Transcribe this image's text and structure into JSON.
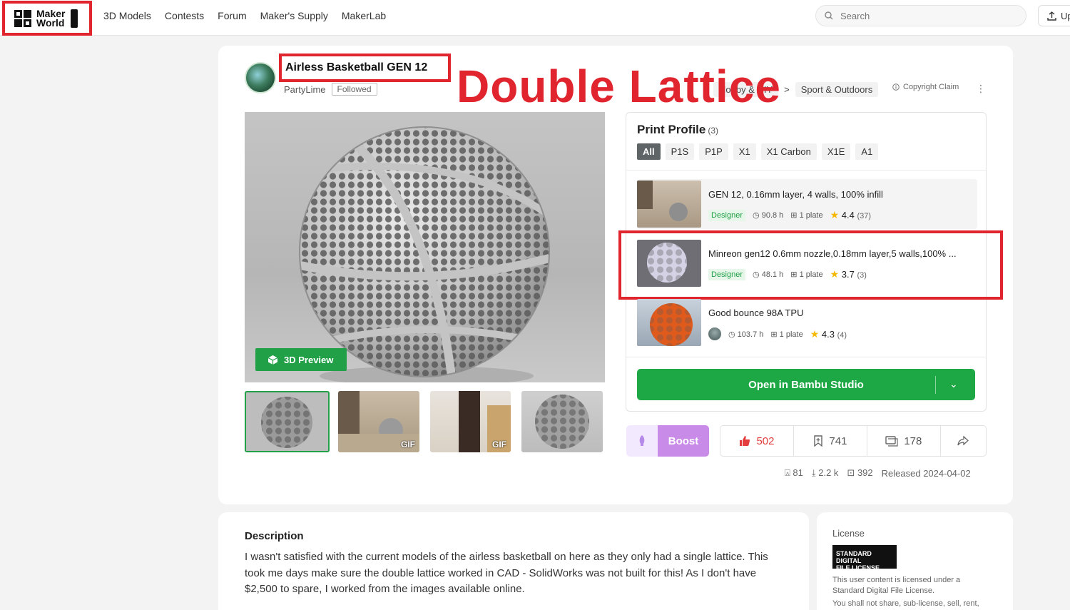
{
  "header": {
    "logo_text_line1": "Maker",
    "logo_text_line2": "World",
    "nav": [
      "3D Models",
      "Contests",
      "Forum",
      "Maker's Supply",
      "MakerLab"
    ],
    "search_placeholder": "Search",
    "upload_label": "Up"
  },
  "model": {
    "title": "Airless Basketball GEN 12",
    "author": "PartyLime",
    "follow_label": "Followed",
    "annotation": "Double Lattice",
    "breadcrumb": [
      "Hobby & DIY",
      "Sport & Outdoors"
    ],
    "copyright_label": "Copyright Claim",
    "preview_label": "3D Preview",
    "thumbnails": [
      {
        "gif": ""
      },
      {
        "gif": "GIF"
      },
      {
        "gif": "GIF"
      },
      {
        "gif": ""
      }
    ]
  },
  "print_profile": {
    "title": "Print Profile",
    "count": "(3)",
    "chips": [
      "All",
      "P1S",
      "P1P",
      "X1",
      "X1 Carbon",
      "X1E",
      "A1"
    ],
    "profiles": [
      {
        "title": "GEN 12, 0.16mm layer, 4 walls, 100% infill",
        "badge": "Designer",
        "time": "90.8 h",
        "plates": "1 plate",
        "rating": "4.4",
        "votes": "(37)"
      },
      {
        "title": "Minreon gen12 0.6mm nozzle,0.18mm layer,5 walls,100% ...",
        "badge": "Designer",
        "time": "48.1 h",
        "plates": "1 plate",
        "rating": "3.7",
        "votes": "(3)"
      },
      {
        "title": "Good bounce 98A TPU",
        "badge": "",
        "time": "103.7 h",
        "plates": "1 plate",
        "rating": "4.3",
        "votes": "(4)"
      }
    ],
    "open_button": "Open in Bambu Studio"
  },
  "actions": {
    "boost": "Boost",
    "likes": "502",
    "collects": "741",
    "comments": "178"
  },
  "stats": {
    "boosts": "81",
    "downloads": "2.2 k",
    "prints": "392",
    "released": "Released 2024-04-02"
  },
  "description": {
    "heading": "Description",
    "body": "I wasn't satisfied with the current models of the airless basketball on here as they only had a single lattice. This took me days make sure the double lattice worked in CAD - SolidWorks was not built for this! As I don't have $2,500 to spare, I worked from the images available online."
  },
  "license": {
    "heading": "License",
    "badge_line1": "STANDARD DIGITAL",
    "badge_line2": "FILE LICENSE",
    "text1": "This user content is licensed under a Standard Digital File License.",
    "text2": "You shall not share, sub-license, sell, rent,"
  },
  "colors": {
    "brand_green": "#1da845",
    "annotation_red": "#e0252f",
    "boost_purple": "#c98be8"
  }
}
